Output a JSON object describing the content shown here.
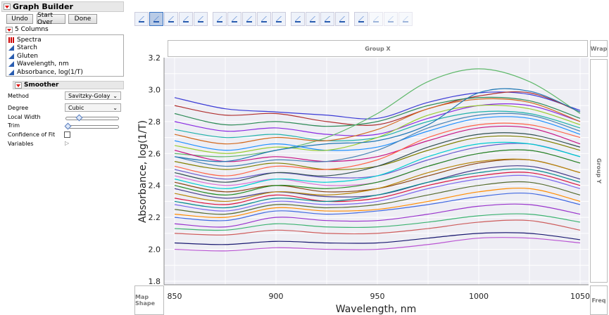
{
  "window": {
    "title": "Graph Builder"
  },
  "buttons": {
    "undo": "Undo",
    "start_over": "Start Over",
    "done": "Done"
  },
  "columns": {
    "header": "5 Columns",
    "items": [
      {
        "label": "Spectra",
        "icon": "bar-chart-icon"
      },
      {
        "label": "Starch",
        "icon": "continuous-icon"
      },
      {
        "label": "Gluten",
        "icon": "continuous-icon"
      },
      {
        "label": "Wavelength, nm",
        "icon": "continuous-icon"
      },
      {
        "label": "Absorbance, log(1/T)",
        "icon": "continuous-icon"
      }
    ]
  },
  "smoother": {
    "title": "Smoother",
    "method_label": "Method",
    "method": "Savitzky-Golay",
    "degree_label": "Degree",
    "degree": "Cubic",
    "local_width_label": "Local Width",
    "local_width": 0.25,
    "trim_label": "Trim",
    "trim": 0.0,
    "confidence_label": "Confidence of Fit",
    "confidence": false,
    "variables_label": "Variables"
  },
  "zones": {
    "group_x": "Group X",
    "group_y": "Group Y",
    "wrap": "Wrap",
    "map_shape": "Map Shape",
    "freq": "Freq"
  },
  "colors": {
    "plot_bg": "#eeeef4",
    "accent": "#3a74c4"
  },
  "chart_data": {
    "type": "line",
    "xlabel": "Wavelength, nm",
    "ylabel": "Absorbance, log(1/T)",
    "xlim": [
      845,
      1052
    ],
    "ylim": [
      1.8,
      3.2
    ],
    "xticks": [
      850,
      900,
      950,
      1000,
      1050
    ],
    "yticks": [
      1.8,
      2.0,
      2.2,
      2.4,
      2.6,
      2.8,
      3.0,
      3.2
    ],
    "grid": true,
    "x": [
      850,
      875,
      900,
      925,
      950,
      975,
      1000,
      1025,
      1050
    ],
    "series": [
      [
        2.95,
        2.88,
        2.86,
        2.84,
        2.82,
        2.92,
        2.98,
        2.97,
        2.87
      ],
      [
        2.9,
        2.84,
        2.85,
        2.8,
        2.78,
        2.88,
        2.96,
        2.98,
        2.86
      ],
      [
        2.85,
        2.78,
        2.8,
        2.77,
        2.8,
        2.9,
        2.95,
        2.93,
        2.82
      ],
      [
        2.8,
        2.74,
        2.76,
        2.72,
        2.72,
        2.82,
        2.9,
        2.9,
        2.8
      ],
      [
        2.6,
        2.58,
        2.62,
        2.7,
        2.85,
        3.05,
        3.13,
        3.05,
        2.85
      ],
      [
        2.75,
        2.7,
        2.72,
        2.68,
        2.7,
        2.8,
        2.86,
        2.85,
        2.76
      ],
      [
        2.72,
        2.66,
        2.7,
        2.68,
        2.75,
        2.88,
        2.94,
        2.92,
        2.8
      ],
      [
        2.68,
        2.62,
        2.66,
        2.62,
        2.64,
        2.74,
        2.82,
        2.82,
        2.72
      ],
      [
        2.65,
        2.6,
        2.64,
        2.62,
        2.7,
        2.84,
        2.9,
        2.88,
        2.78
      ],
      [
        2.62,
        2.55,
        2.58,
        2.55,
        2.58,
        2.68,
        2.76,
        2.76,
        2.66
      ],
      [
        2.58,
        2.52,
        2.56,
        2.55,
        2.62,
        2.76,
        2.84,
        2.84,
        2.74
      ],
      [
        2.55,
        2.5,
        2.54,
        2.5,
        2.52,
        2.62,
        2.7,
        2.7,
        2.62
      ],
      [
        2.52,
        2.46,
        2.52,
        2.5,
        2.56,
        2.7,
        2.78,
        2.78,
        2.7
      ],
      [
        2.5,
        2.44,
        2.48,
        2.45,
        2.46,
        2.56,
        2.64,
        2.66,
        2.58
      ],
      [
        2.48,
        2.42,
        2.48,
        2.46,
        2.52,
        2.64,
        2.72,
        2.72,
        2.64
      ],
      [
        2.46,
        2.4,
        2.44,
        2.4,
        2.42,
        2.52,
        2.6,
        2.62,
        2.54
      ],
      [
        2.44,
        2.38,
        2.44,
        2.42,
        2.46,
        2.58,
        2.66,
        2.66,
        2.58
      ],
      [
        2.42,
        2.36,
        2.4,
        2.36,
        2.38,
        2.46,
        2.54,
        2.56,
        2.48
      ],
      [
        2.4,
        2.34,
        2.4,
        2.38,
        2.42,
        2.52,
        2.6,
        2.62,
        2.54
      ],
      [
        2.38,
        2.32,
        2.36,
        2.33,
        2.34,
        2.42,
        2.5,
        2.52,
        2.44
      ],
      [
        2.35,
        2.3,
        2.36,
        2.34,
        2.38,
        2.48,
        2.55,
        2.56,
        2.48
      ],
      [
        2.32,
        2.28,
        2.34,
        2.3,
        2.32,
        2.4,
        2.46,
        2.48,
        2.4
      ],
      [
        2.3,
        2.26,
        2.32,
        2.3,
        2.34,
        2.42,
        2.48,
        2.5,
        2.42
      ],
      [
        2.28,
        2.24,
        2.3,
        2.28,
        2.3,
        2.38,
        2.44,
        2.46,
        2.38
      ],
      [
        2.25,
        2.22,
        2.28,
        2.26,
        2.28,
        2.34,
        2.4,
        2.42,
        2.34
      ],
      [
        2.22,
        2.2,
        2.26,
        2.24,
        2.25,
        2.3,
        2.36,
        2.38,
        2.3
      ],
      [
        2.2,
        2.18,
        2.24,
        2.22,
        2.24,
        2.28,
        2.33,
        2.35,
        2.28
      ],
      [
        2.16,
        2.14,
        2.2,
        2.18,
        2.18,
        2.22,
        2.27,
        2.28,
        2.22
      ],
      [
        2.13,
        2.12,
        2.16,
        2.14,
        2.14,
        2.17,
        2.21,
        2.22,
        2.17
      ],
      [
        2.1,
        2.09,
        2.12,
        2.1,
        2.1,
        2.13,
        2.17,
        2.18,
        2.12
      ],
      [
        2.04,
        2.03,
        2.05,
        2.04,
        2.04,
        2.07,
        2.1,
        2.1,
        2.06
      ],
      [
        2.0,
        1.99,
        2.01,
        2.0,
        2.0,
        2.03,
        2.07,
        2.07,
        2.04
      ],
      [
        2.58,
        2.55,
        2.62,
        2.66,
        2.68,
        2.78,
        2.98,
        2.99,
        2.86
      ]
    ],
    "palette": [
      "#3b3bd6",
      "#b03030",
      "#2e8b57",
      "#8a2be2",
      "#5fb86a",
      "#20b2aa",
      "#d2691e",
      "#1e90ff",
      "#9acd32",
      "#c71585",
      "#4682b4",
      "#808000",
      "#ff6347",
      "#6a5acd",
      "#2f4f4f",
      "#da70d6",
      "#00ced1",
      "#8b4513",
      "#228b22",
      "#483d8b",
      "#b8860b",
      "#dc143c",
      "#008b8b",
      "#7b68ee",
      "#556b2f",
      "#ff8c00",
      "#4169e1",
      "#9932cc",
      "#3cb371",
      "#cd5c5c",
      "#191970",
      "#ba55d3",
      "#1f77b4"
    ]
  }
}
